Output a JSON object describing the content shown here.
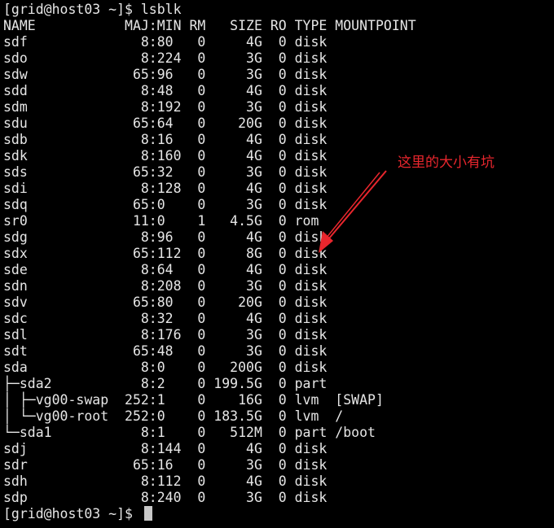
{
  "terminal": {
    "prompt_top": "[grid@host03 ~]$ lsblk",
    "header": "NAME           MAJ:MIN RM   SIZE RO TYPE MOUNTPOINT",
    "rows": [
      "sdf              8:80   0     4G  0 disk",
      "sdo              8:224  0     3G  0 disk",
      "sdw             65:96   0     3G  0 disk",
      "sdd              8:48   0     4G  0 disk",
      "sdm              8:192  0     3G  0 disk",
      "sdu             65:64   0    20G  0 disk",
      "sdb              8:16   0     4G  0 disk",
      "sdk              8:160  0     4G  0 disk",
      "sds             65:32   0     3G  0 disk",
      "sdi              8:128  0     4G  0 disk",
      "sdq             65:0    0     3G  0 disk",
      "sr0             11:0    1   4.5G  0 rom",
      "sdg              8:96   0     4G  0 disk",
      "sdx             65:112  0     8G  0 disk",
      "sde              8:64   0     4G  0 disk",
      "sdn              8:208  0     3G  0 disk",
      "sdv             65:80   0    20G  0 disk",
      "sdc              8:32   0     4G  0 disk",
      "sdl              8:176  0     3G  0 disk",
      "sdt             65:48   0     3G  0 disk",
      "sda              8:0    0   200G  0 disk",
      "├─sda2           8:2    0 199.5G  0 part",
      "│ ├─vg00-swap  252:1    0    16G  0 lvm  [SWAP]",
      "│ └─vg00-root  252:0    0 183.5G  0 lvm  /",
      "└─sda1           8:1    0   512M  0 part /boot",
      "sdj              8:144  0     4G  0 disk",
      "sdr             65:16   0     3G  0 disk",
      "sdh              8:112  0     4G  0 disk",
      "sdp              8:240  0     3G  0 disk"
    ],
    "prompt_bottom": "[grid@host03 ~]$ "
  },
  "annotation": {
    "text": "这里的大小有坑",
    "color": "#e8262d"
  },
  "colors": {
    "background": "#000000",
    "foreground": "#e6e6e6",
    "cursor": "#c8c8c8"
  }
}
